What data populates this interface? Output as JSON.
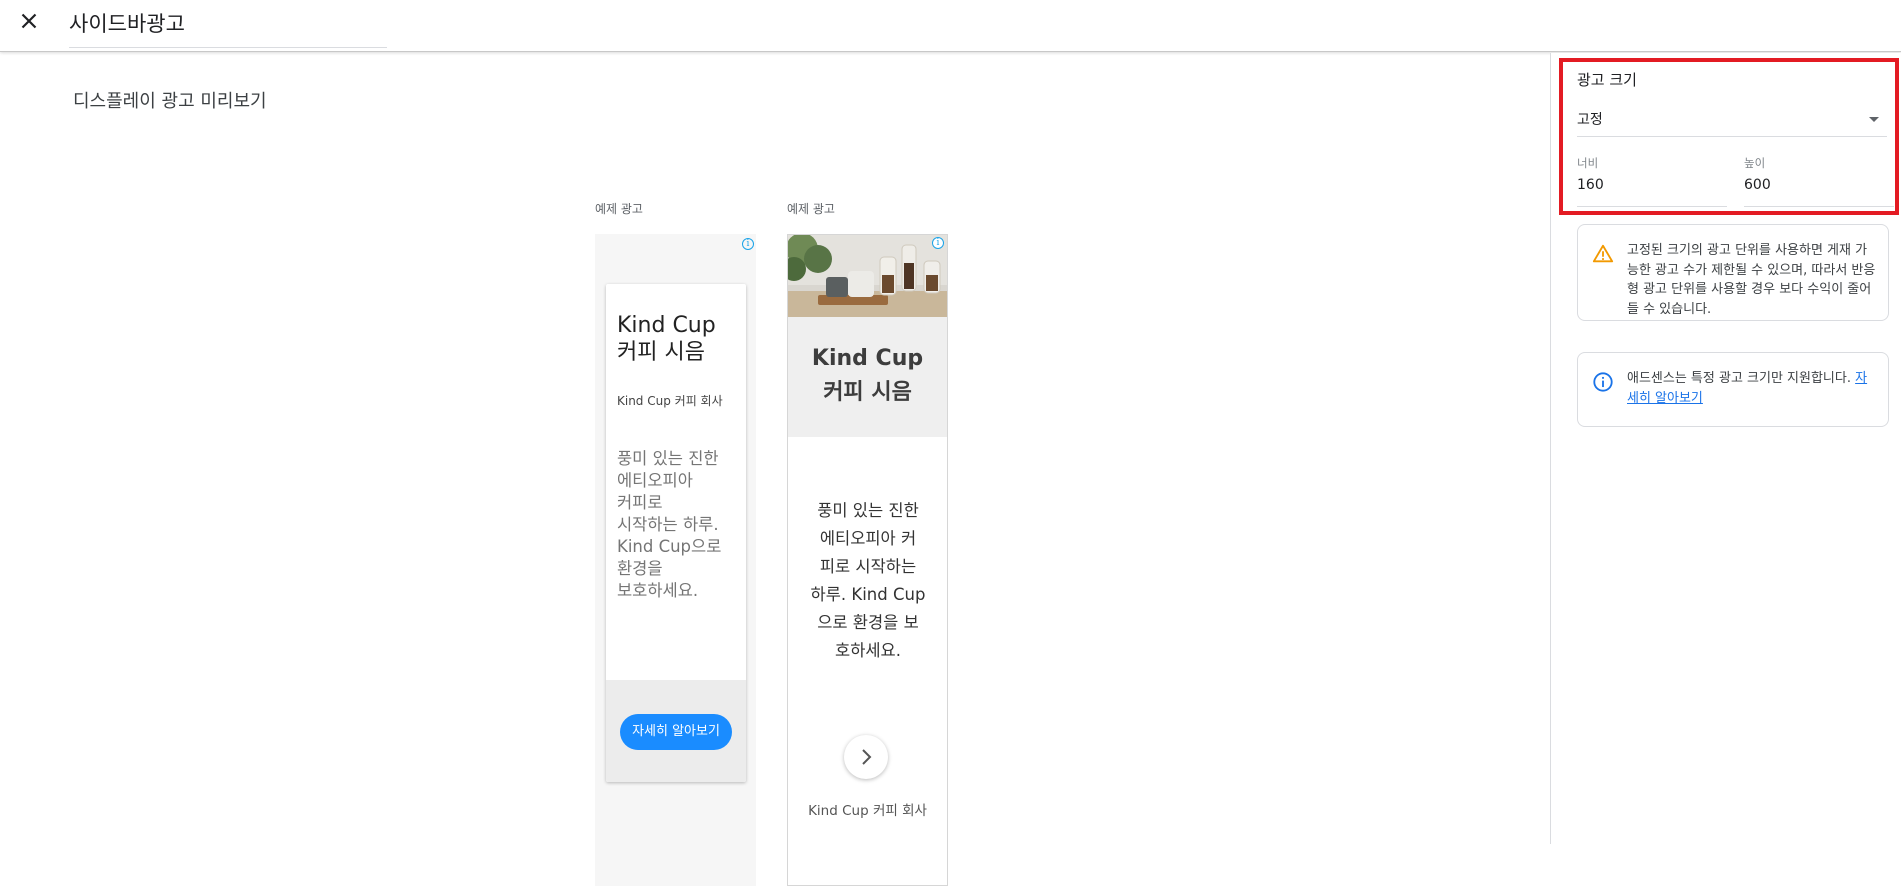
{
  "header": {
    "close_icon": "close-icon",
    "title": "사이드바광고"
  },
  "preview": {
    "title": "디스플레이 광고 미리보기",
    "ads": [
      {
        "label": "예제 광고",
        "headline_line1": "Kind Cup",
        "headline_line2": "커피 시음",
        "company": "Kind Cup 커피 회사",
        "description_lines": [
          "풍미 있는 진한",
          "에티오피아",
          "커피로",
          "시작하는 하루.",
          "Kind Cup으로",
          "환경을",
          "보호하세요."
        ],
        "cta": "자세히 알아보기"
      },
      {
        "label": "예제 광고",
        "headline_line1": "Kind Cup",
        "headline_line2": "커피 시음",
        "description_lines": [
          "풍미 있는 진한",
          "에티오피아 커",
          "피로 시작하는",
          "하루. Kind Cup",
          "으로 환경을 보",
          "호하세요."
        ],
        "company": "Kind Cup 커피 회사",
        "arrow_icon": "chevron-right-icon"
      }
    ]
  },
  "side_panel": {
    "heading": "광고 크기",
    "size_type": "고정",
    "width_label": "너비",
    "width_value": "160",
    "height_label": "높이",
    "height_value": "600",
    "warning_text": "고정된 크기의 광고 단위를 사용하면 게재 가능한 광고 수가 제한될 수 있으며, 따라서 반응형 광고 단위를 사용할 경우 보다 수익이 줄어들 수 있습니다.",
    "info_text": "애드센스는 특정 광고 크기만 지원합니다.",
    "info_link": "자세히 알아보기"
  },
  "colors": {
    "accent_blue": "#1a73e8",
    "cta_blue": "#1a8cff",
    "highlight_red": "#e31b23",
    "warning_orange": "#f29900"
  }
}
